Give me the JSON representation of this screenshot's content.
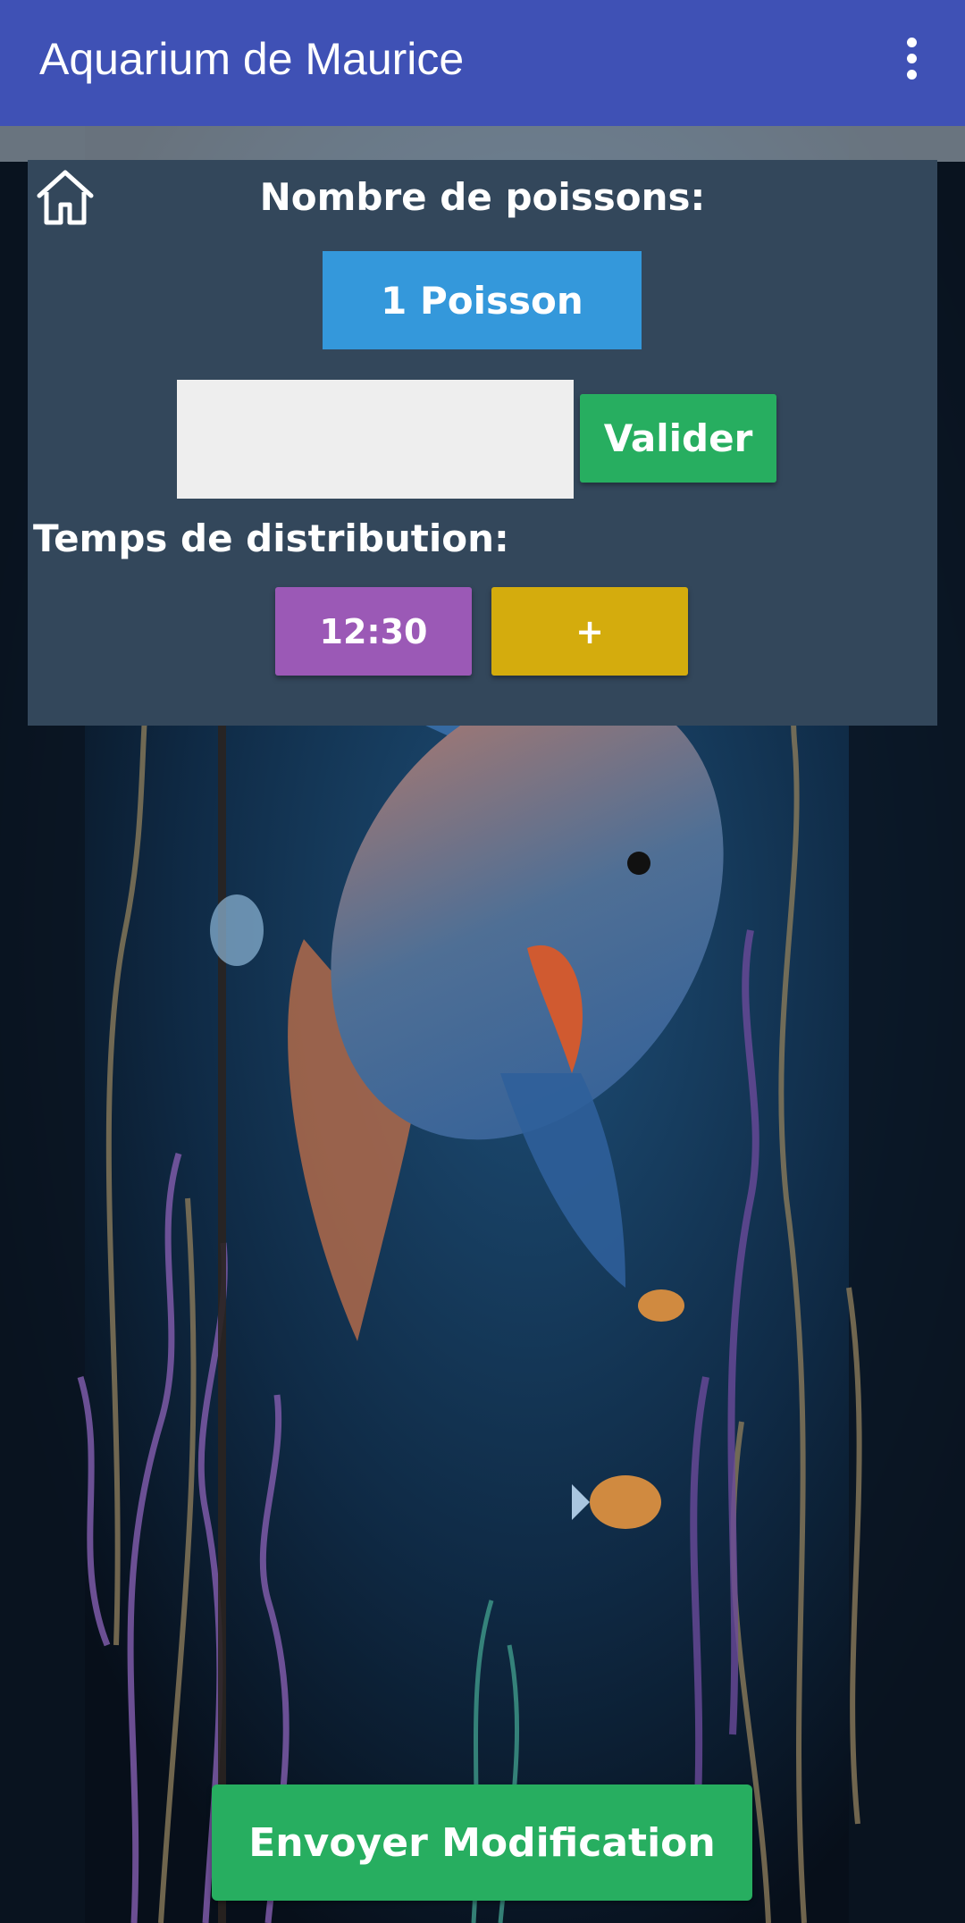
{
  "app": {
    "title": "Aquarium de Maurice"
  },
  "panel": {
    "fish_count_label": "Nombre de poissons:",
    "fish_count_button": "1 Poisson",
    "input_value": "",
    "validate_button": "Valider",
    "distribution_label": "Temps de distribution:",
    "time_button": "12:30",
    "add_button": "+"
  },
  "footer": {
    "send_button": "Envoyer Modification"
  },
  "colors": {
    "appbar": "#3f51b5",
    "panel": "#33475b",
    "blue_button": "#3498db",
    "green_button": "#27ae60",
    "purple_button": "#9b59b6",
    "yellow_button": "#d4ac0d"
  },
  "icons": {
    "home": "home-icon",
    "overflow": "overflow-menu-icon"
  }
}
